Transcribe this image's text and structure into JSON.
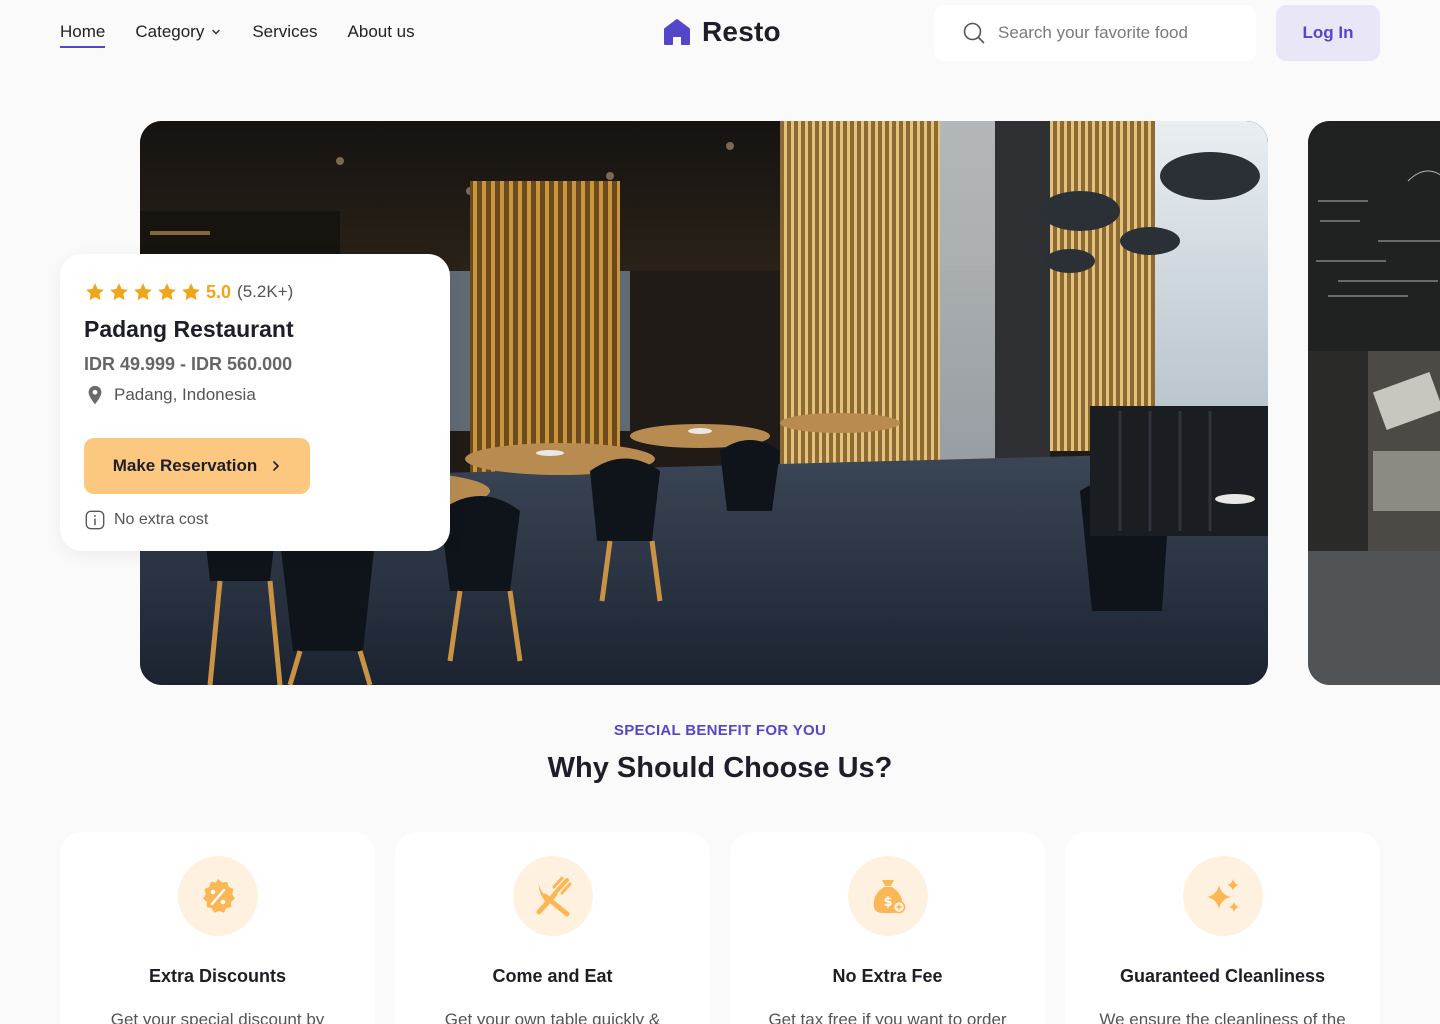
{
  "nav": {
    "links": [
      "Home",
      "Category",
      "Services",
      "About us"
    ],
    "active": "Home"
  },
  "logo": {
    "text": "Resto"
  },
  "search": {
    "placeholder": "Search your favorite food"
  },
  "login": {
    "label": "Log In"
  },
  "hero": {
    "rating_value": "5.0",
    "rating_count": "(5.2K+)",
    "stars": 5,
    "name": "Padang Restaurant",
    "price": "IDR 49.999 - IDR 560.000",
    "location": "Padang, Indonesia",
    "cta": "Make Reservation",
    "note": "No extra cost"
  },
  "benefits": {
    "eyebrow": "SPECIAL BENEFIT FOR YOU",
    "title": "Why Should Choose Us?",
    "items": [
      {
        "icon": "discount-badge-icon",
        "title": "Extra Discounts",
        "desc": "Get your special discount by"
      },
      {
        "icon": "utensils-icon",
        "title": "Come and Eat",
        "desc": "Get your own table quickly &"
      },
      {
        "icon": "money-bag-icon",
        "title": "No Extra Fee",
        "desc": "Get tax free if you want to order"
      },
      {
        "icon": "sparkles-icon",
        "title": "Guaranteed Cleanliness",
        "desc": "We ensure the cleanliness of the"
      }
    ]
  },
  "colors": {
    "primary": "#5446c9",
    "accent": "#fcc880",
    "star": "#f2a51a",
    "icon_bg": "#fff1df"
  }
}
